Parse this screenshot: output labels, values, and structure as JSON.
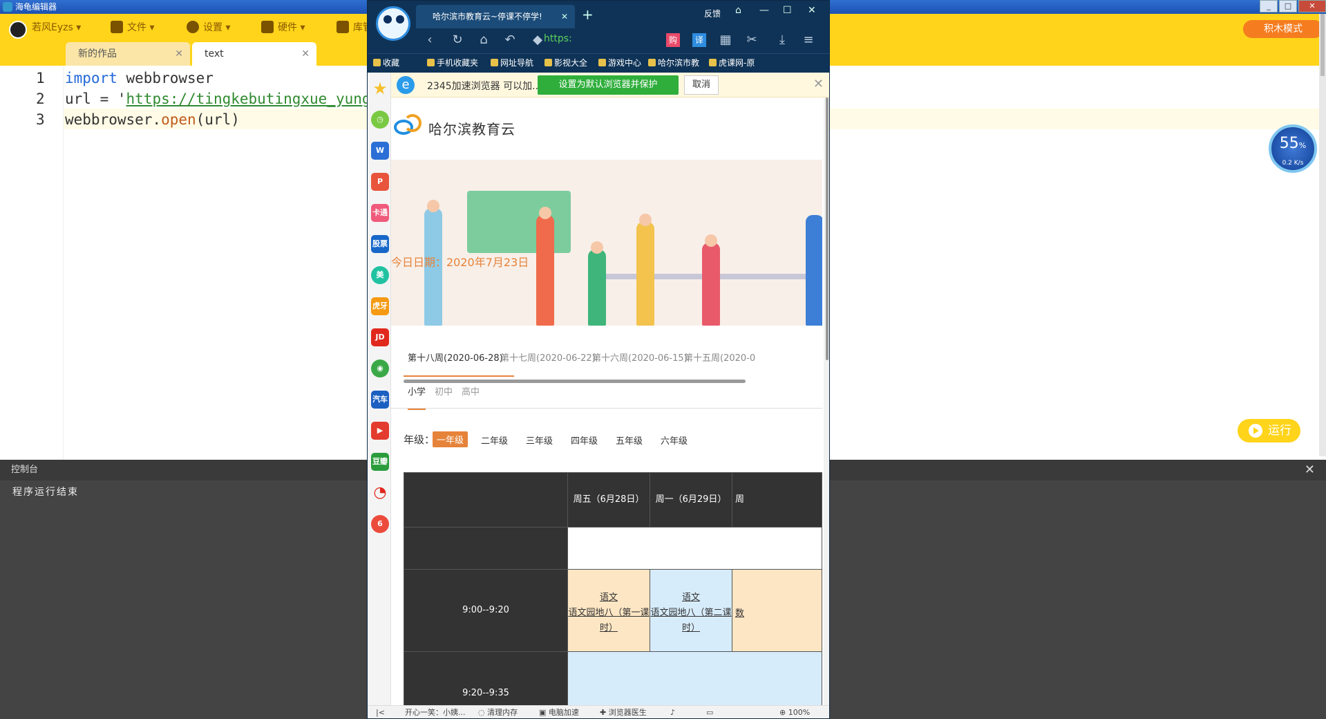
{
  "editor": {
    "window_title": "海龟编辑器",
    "toolbar": {
      "user": "若风Eyzs",
      "file": "文件",
      "settings": "设置",
      "hardware": "硬件",
      "library": "库管"
    },
    "blocks_mode": "积木模式",
    "tabs": [
      {
        "label": "新的作品"
      },
      {
        "label": "text"
      }
    ],
    "line_numbers": [
      "1",
      "2",
      "3"
    ],
    "code": {
      "l1_kw": "import",
      "l1_rest": " webbrowser",
      "l2_var": "url = '",
      "l2_str": "https://tingkebutingxue_yungu",
      "l3_obj": "webbrowser.",
      "l3_fn": "open",
      "l3_args": "(url)"
    },
    "run_label": "运行",
    "speed": {
      "percent": "55",
      "unit": "%",
      "rate": "0.2 K/s"
    },
    "console": {
      "title": "控制台",
      "output": "程序运行结束"
    },
    "colors": {
      "toolbar": "#ffd41a",
      "run": "#ffd41a",
      "blocks": "#f57c1f"
    }
  },
  "browser": {
    "tab_title": "哈尔滨市教育云~停课不停学!",
    "feedback": "反馈",
    "url_scheme": "https:",
    "bookmarks": [
      "收藏",
      "手机收藏夹",
      "网址导航",
      "影视大全",
      "游戏中心",
      "哈尔滨市教",
      "虎课网-原"
    ],
    "sidebar": [
      "卡通",
      "股票",
      "美",
      "虎牙",
      "JD",
      "汽车",
      "豆瓣",
      "6"
    ],
    "notice": {
      "text": "2345加速浏览器 可以加...",
      "primary": "设置为默认浏览器并保护",
      "secondary": "取消"
    },
    "page": {
      "site_name": "哈尔滨教育云",
      "date": "今日日期：2020年7月23日",
      "weeks": [
        "第十八周(2020-06-28)",
        "第十七周(2020-06-22)",
        "第十六周(2020-06-15)",
        "第十五周(2020-0"
      ],
      "levels": [
        "小学",
        "初中",
        "高中"
      ],
      "grade_label": "年级：",
      "grades": [
        "一年级",
        "二年级",
        "三年级",
        "四年级",
        "五年级",
        "六年级"
      ],
      "schedule": {
        "days": [
          "周五（6月28日）",
          "周一（6月29日）",
          "周"
        ],
        "times": [
          "9:00--9:20",
          "9:20--9:35"
        ],
        "row1": [
          {
            "subject": "语文",
            "topic": "语文园地八（第一课时）"
          },
          {
            "subject": "语文",
            "topic": "语文园地八（第二课时）"
          },
          {
            "subject": "数"
          }
        ]
      }
    },
    "status": [
      "开心一笑：小姨...",
      "清理内存",
      "电脑加速",
      "浏览器医生",
      "100%"
    ]
  }
}
